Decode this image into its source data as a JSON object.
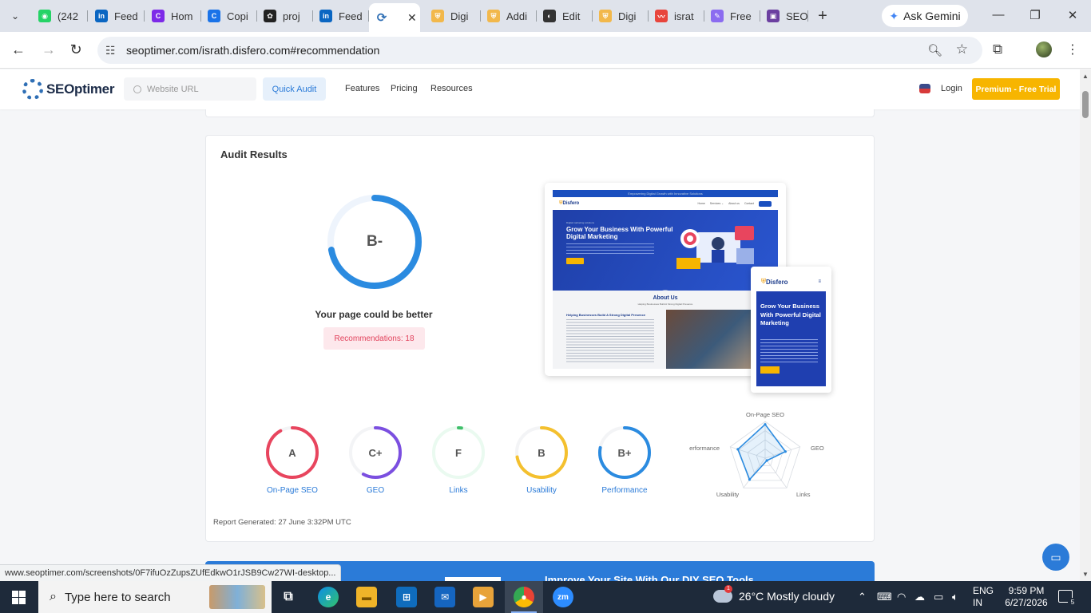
{
  "browser": {
    "tabs": [
      {
        "label": "(242",
        "icon": "whatsapp-icon",
        "color": "#25d366",
        "glyph": "◉"
      },
      {
        "label": "Feed",
        "icon": "linkedin-icon",
        "color": "#0a66c2",
        "glyph": "in"
      },
      {
        "label": "Hom",
        "icon": "canva-icon",
        "color": "#7d2ae8",
        "glyph": "C"
      },
      {
        "label": "Copi",
        "icon": "copilot-icon",
        "color": "#1a73e8",
        "glyph": "C"
      },
      {
        "label": "proj",
        "icon": "openai-icon",
        "color": "#222222",
        "glyph": "✿"
      },
      {
        "label": "Feed",
        "icon": "linkedin-icon",
        "color": "#0a66c2",
        "glyph": "in"
      },
      {
        "label": "",
        "icon": "seoptimer-icon",
        "color": "#2f6fb5",
        "glyph": "⟳",
        "active": true
      },
      {
        "label": "Digi",
        "icon": "shield-icon",
        "color": "#f2b84b",
        "glyph": "⛨"
      },
      {
        "label": "Addi",
        "icon": "shield-icon",
        "color": "#f2b84b",
        "glyph": "⛨"
      },
      {
        "label": "Edit",
        "icon": "circle-icon",
        "color": "#333333",
        "glyph": "◐"
      },
      {
        "label": "Digi",
        "icon": "shield-icon",
        "color": "#f2b84b",
        "glyph": "⛨"
      },
      {
        "label": "israt",
        "icon": "wave-icon",
        "color": "#e8453c",
        "glyph": "〰"
      },
      {
        "label": "Free",
        "icon": "feather-icon",
        "color": "#8b6cf0",
        "glyph": "✎"
      },
      {
        "label": "SEO",
        "icon": "seo-icon",
        "color": "#6b3fa0",
        "glyph": "▣"
      }
    ],
    "ask_gemini": "Ask Gemini",
    "url": "seoptimer.com/israth.disfero.com#recommendation",
    "status_url": "www.seoptimer.com/screenshots/0F7ifuOzZupsZUfEdkwO1rJSB9Cw27WI-desktop..."
  },
  "site": {
    "logo": "SEOptimer",
    "url_placeholder": "Website URL",
    "quick_audit": "Quick Audit",
    "nav": [
      "Features",
      "Pricing",
      "Resources"
    ],
    "login": "Login",
    "premium": "Premium - Free Trial"
  },
  "audit": {
    "title": "Audit Results",
    "overall_grade": "B-",
    "overall_score": 0.72,
    "verdict": "Your page could be better",
    "recommendations": "Recommendations: 18",
    "categories": [
      {
        "grade": "A",
        "label": "On-Page SEO",
        "color": "#e8455e",
        "score": 0.92
      },
      {
        "grade": "C+",
        "label": "GEO",
        "color": "#7b4fe0",
        "score": 0.58
      },
      {
        "grade": "F",
        "label": "Links",
        "color": "#3fbf6a",
        "score": 0.02
      },
      {
        "grade": "B",
        "label": "Usability",
        "color": "#f4c02e",
        "score": 0.72
      },
      {
        "grade": "B+",
        "label": "Performance",
        "color": "#2b8be0",
        "score": 0.78
      }
    ],
    "radar": {
      "axes": [
        "On-Page SEO",
        "GEO",
        "Links",
        "Usability",
        "Performance"
      ],
      "values": [
        0.92,
        0.58,
        0.02,
        0.72,
        0.78
      ],
      "color": "#2b8be0"
    },
    "report_generated": "Report Generated: 27 June 3:32PM UTC"
  },
  "preview": {
    "desktop_topbar": "Empowering Digital Growth with Innovative Solutions",
    "brand": "Disfero",
    "desktop_nav": [
      "Home",
      "Services ⌄",
      "About us",
      "Contact"
    ],
    "tagline": "Digital marketing solutions",
    "hero": "Grow Your Business With Powerful Digital Marketing",
    "cta": "View More",
    "about_title": "About Us",
    "about_sub": "Helping Businesses Build A Strong Digital Presence",
    "about_heading": "Helping Businesses Build A Strong Digital Presence"
  },
  "cta_banner": "Improve Your Site With Our DIY SEO Tools",
  "taskbar": {
    "search_placeholder": "Type here to search",
    "weather": "26°C  Mostly cloudy",
    "weather_badge": "1",
    "lang_top": "ENG",
    "lang_bottom": "IN",
    "time": "9:59 PM",
    "date": "6/27/2026",
    "notifications": "5"
  }
}
